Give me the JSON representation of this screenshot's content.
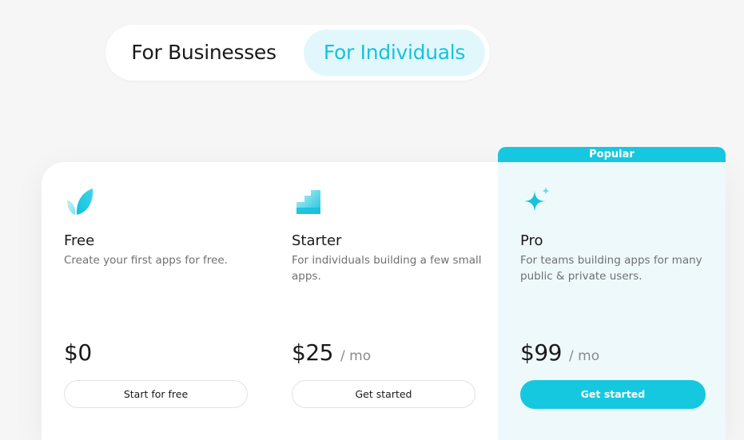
{
  "audience_toggle": {
    "options": [
      "For Businesses",
      "For Individuals"
    ],
    "selected": "For Individuals"
  },
  "colors": {
    "accent": "#15c8e0",
    "accent_light": "#e2f7fb",
    "pro_background": "#eef9fc"
  },
  "plans": [
    {
      "icon": "leaf-icon",
      "name": "Free",
      "description": "Create your first apps for free.",
      "price": "$0",
      "period": "",
      "cta": "Start for free"
    },
    {
      "icon": "stairs-icon",
      "name": "Starter",
      "description": "For individuals building a few small apps.",
      "price": "$25",
      "period": "/ mo",
      "cta": "Get started"
    },
    {
      "icon": "sparkle-icon",
      "name": "Pro",
      "badge": "Popular",
      "description": "For teams building apps for many public & private users.",
      "price": "$99",
      "period": "/ mo",
      "cta": "Get started"
    }
  ]
}
